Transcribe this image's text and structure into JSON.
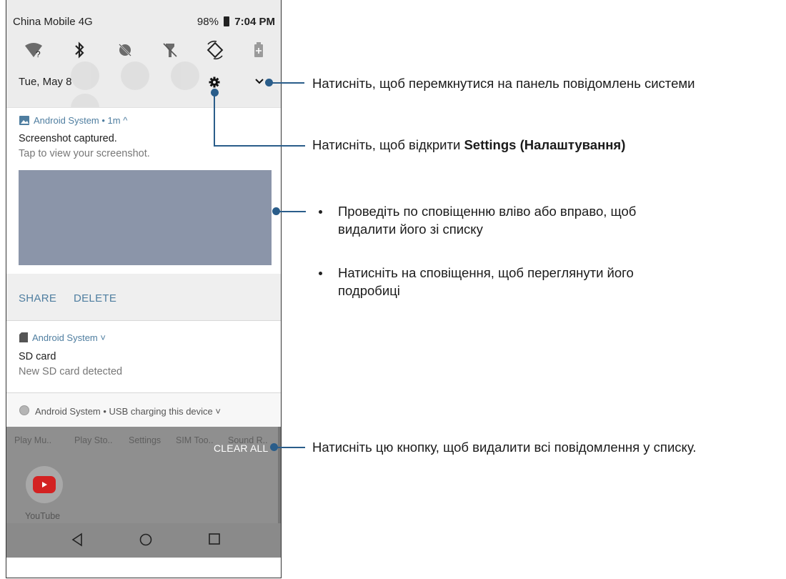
{
  "status_bar": {
    "carrier": "China Mobile 4G",
    "battery": "98%",
    "time": "7:04 PM"
  },
  "quick_settings": {
    "icons": [
      "wifi-icon",
      "bluetooth-icon",
      "location-off-icon",
      "flashlight-off-icon",
      "auto-rotate-icon",
      "battery-saver-icon"
    ]
  },
  "header": {
    "date": "Tue, May 8"
  },
  "notification_screenshot": {
    "app_line": "Android System • 1m ^",
    "title": "Screenshot captured.",
    "subtitle": "Tap to view your screenshot.",
    "actions": [
      "SHARE",
      "DELETE"
    ]
  },
  "notification_sd": {
    "app_line": "Android System ˅",
    "title": "SD card",
    "subtitle": "New SD card detected"
  },
  "notification_usb": {
    "app_line": "Android System • USB charging this device ˅"
  },
  "recents": {
    "apps": [
      "Play Mu..",
      "Play Sto..",
      "Settings",
      "SIM Too..",
      "Sound R.."
    ],
    "clear_all": "CLEAR ALL",
    "youtube_label": "YouTube"
  },
  "nav": {
    "icons": [
      "back-icon",
      "home-icon",
      "recents-icon"
    ]
  },
  "callouts": {
    "expand": "Натисніть, щоб перемкнутися на панель повідомлень системи",
    "settings_prefix": "Натисніть, щоб відкрити ",
    "settings_bold": "Settings (Налаштування)",
    "bullet1": "Проведіть по сповіщенню вліво або вправо, щоб видалити його зі списку",
    "bullet2": "Натисніть на сповіщення, щоб переглянути його подробиці",
    "clear_all": "Натисніть цю кнопку, щоб видалити всі повідомлення у списку."
  },
  "colors": {
    "accent": "#4f7ea0",
    "callout_line": "#2a5d8a",
    "thumbnail": "#8b95a9",
    "recents_bg": "#8f8f8f"
  }
}
